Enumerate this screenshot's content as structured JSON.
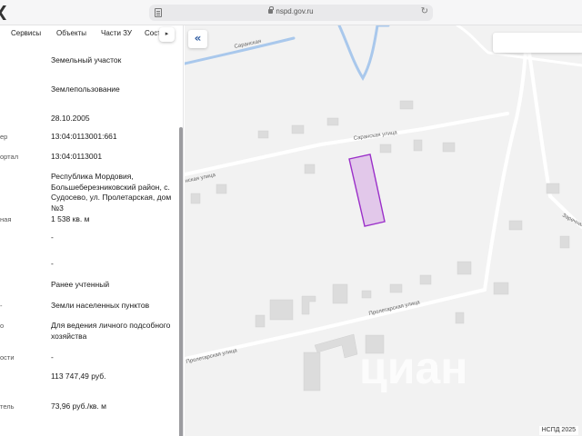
{
  "browser": {
    "back_glyph": "❮",
    "url": "nspd.gov.ru",
    "doc_icon": "document-icon",
    "lock_icon": "lock-icon",
    "reload_glyph": "↻"
  },
  "tabs": {
    "items": [
      "Сервисы",
      "Объекты",
      "Части ЗУ",
      "Сост"
    ],
    "next_glyph": "▸"
  },
  "attributes": [
    {
      "label": "",
      "value": "Земельный участок"
    },
    {
      "label": "",
      "value": "Землепользование"
    },
    {
      "label": "",
      "value": "28.10.2005"
    },
    {
      "label": "ер",
      "value": "13:04:0113001:661"
    },
    {
      "label": "ортал",
      "value": "13:04:0113001"
    },
    {
      "label": "",
      "value": "Республика Мордовия, Большеберезниковский район, с. Судосево, ул. Пролетарская, дом №3"
    },
    {
      "label": "ная",
      "value": "1 538 кв. м"
    },
    {
      "label": "",
      "value": "-"
    },
    {
      "label": "",
      "value": "-"
    },
    {
      "label": "",
      "value": "Ранее учтенный"
    },
    {
      "label": "-",
      "value": "Земли населенных пунктов"
    },
    {
      "label": "о",
      "value": "Для ведения личного подсобного хозяйства"
    },
    {
      "label": "ости",
      "value": "-"
    },
    {
      "label": "",
      "value": "113 747,49 руб."
    },
    {
      "label": "тель",
      "value": "73,96 руб./кв. м"
    }
  ],
  "map": {
    "collapse_glyph": "«",
    "streets": {
      "saranskaya": "Саранская улица",
      "saranskaya_left": "нская улица",
      "proletarskaya": "Пролетарская улица",
      "proletarskaya_left": "Пролетарская улица",
      "top_left": "Саранская",
      "right_edge": "Заречная"
    },
    "watermark": "циан",
    "copyright": "НСПД 2025",
    "colors": {
      "background": "#f2f2f2",
      "road": "#ffffff",
      "building": "#dcdcdc",
      "river": "#a9c8ec",
      "parcel_fill": "#e2c8ea",
      "parcel_stroke": "#9b30c9"
    }
  }
}
